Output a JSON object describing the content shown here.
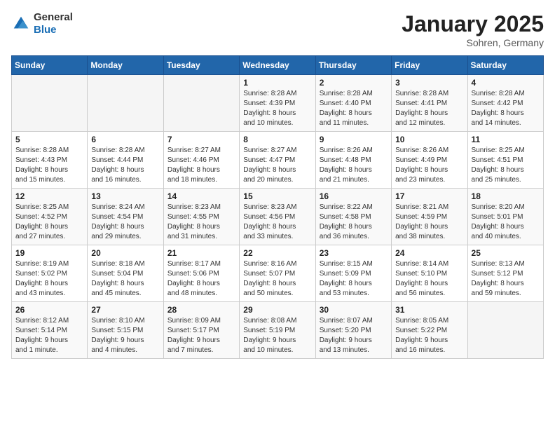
{
  "logo": {
    "text_general": "General",
    "text_blue": "Blue"
  },
  "title": "January 2025",
  "location": "Sohren, Germany",
  "weekdays": [
    "Sunday",
    "Monday",
    "Tuesday",
    "Wednesday",
    "Thursday",
    "Friday",
    "Saturday"
  ],
  "weeks": [
    [
      {
        "day": "",
        "info": ""
      },
      {
        "day": "",
        "info": ""
      },
      {
        "day": "",
        "info": ""
      },
      {
        "day": "1",
        "info": "Sunrise: 8:28 AM\nSunset: 4:39 PM\nDaylight: 8 hours\nand 10 minutes."
      },
      {
        "day": "2",
        "info": "Sunrise: 8:28 AM\nSunset: 4:40 PM\nDaylight: 8 hours\nand 11 minutes."
      },
      {
        "day": "3",
        "info": "Sunrise: 8:28 AM\nSunset: 4:41 PM\nDaylight: 8 hours\nand 12 minutes."
      },
      {
        "day": "4",
        "info": "Sunrise: 8:28 AM\nSunset: 4:42 PM\nDaylight: 8 hours\nand 14 minutes."
      }
    ],
    [
      {
        "day": "5",
        "info": "Sunrise: 8:28 AM\nSunset: 4:43 PM\nDaylight: 8 hours\nand 15 minutes."
      },
      {
        "day": "6",
        "info": "Sunrise: 8:28 AM\nSunset: 4:44 PM\nDaylight: 8 hours\nand 16 minutes."
      },
      {
        "day": "7",
        "info": "Sunrise: 8:27 AM\nSunset: 4:46 PM\nDaylight: 8 hours\nand 18 minutes."
      },
      {
        "day": "8",
        "info": "Sunrise: 8:27 AM\nSunset: 4:47 PM\nDaylight: 8 hours\nand 20 minutes."
      },
      {
        "day": "9",
        "info": "Sunrise: 8:26 AM\nSunset: 4:48 PM\nDaylight: 8 hours\nand 21 minutes."
      },
      {
        "day": "10",
        "info": "Sunrise: 8:26 AM\nSunset: 4:49 PM\nDaylight: 8 hours\nand 23 minutes."
      },
      {
        "day": "11",
        "info": "Sunrise: 8:25 AM\nSunset: 4:51 PM\nDaylight: 8 hours\nand 25 minutes."
      }
    ],
    [
      {
        "day": "12",
        "info": "Sunrise: 8:25 AM\nSunset: 4:52 PM\nDaylight: 8 hours\nand 27 minutes."
      },
      {
        "day": "13",
        "info": "Sunrise: 8:24 AM\nSunset: 4:54 PM\nDaylight: 8 hours\nand 29 minutes."
      },
      {
        "day": "14",
        "info": "Sunrise: 8:23 AM\nSunset: 4:55 PM\nDaylight: 8 hours\nand 31 minutes."
      },
      {
        "day": "15",
        "info": "Sunrise: 8:23 AM\nSunset: 4:56 PM\nDaylight: 8 hours\nand 33 minutes."
      },
      {
        "day": "16",
        "info": "Sunrise: 8:22 AM\nSunset: 4:58 PM\nDaylight: 8 hours\nand 36 minutes."
      },
      {
        "day": "17",
        "info": "Sunrise: 8:21 AM\nSunset: 4:59 PM\nDaylight: 8 hours\nand 38 minutes."
      },
      {
        "day": "18",
        "info": "Sunrise: 8:20 AM\nSunset: 5:01 PM\nDaylight: 8 hours\nand 40 minutes."
      }
    ],
    [
      {
        "day": "19",
        "info": "Sunrise: 8:19 AM\nSunset: 5:02 PM\nDaylight: 8 hours\nand 43 minutes."
      },
      {
        "day": "20",
        "info": "Sunrise: 8:18 AM\nSunset: 5:04 PM\nDaylight: 8 hours\nand 45 minutes."
      },
      {
        "day": "21",
        "info": "Sunrise: 8:17 AM\nSunset: 5:06 PM\nDaylight: 8 hours\nand 48 minutes."
      },
      {
        "day": "22",
        "info": "Sunrise: 8:16 AM\nSunset: 5:07 PM\nDaylight: 8 hours\nand 50 minutes."
      },
      {
        "day": "23",
        "info": "Sunrise: 8:15 AM\nSunset: 5:09 PM\nDaylight: 8 hours\nand 53 minutes."
      },
      {
        "day": "24",
        "info": "Sunrise: 8:14 AM\nSunset: 5:10 PM\nDaylight: 8 hours\nand 56 minutes."
      },
      {
        "day": "25",
        "info": "Sunrise: 8:13 AM\nSunset: 5:12 PM\nDaylight: 8 hours\nand 59 minutes."
      }
    ],
    [
      {
        "day": "26",
        "info": "Sunrise: 8:12 AM\nSunset: 5:14 PM\nDaylight: 9 hours\nand 1 minute."
      },
      {
        "day": "27",
        "info": "Sunrise: 8:10 AM\nSunset: 5:15 PM\nDaylight: 9 hours\nand 4 minutes."
      },
      {
        "day": "28",
        "info": "Sunrise: 8:09 AM\nSunset: 5:17 PM\nDaylight: 9 hours\nand 7 minutes."
      },
      {
        "day": "29",
        "info": "Sunrise: 8:08 AM\nSunset: 5:19 PM\nDaylight: 9 hours\nand 10 minutes."
      },
      {
        "day": "30",
        "info": "Sunrise: 8:07 AM\nSunset: 5:20 PM\nDaylight: 9 hours\nand 13 minutes."
      },
      {
        "day": "31",
        "info": "Sunrise: 8:05 AM\nSunset: 5:22 PM\nDaylight: 9 hours\nand 16 minutes."
      },
      {
        "day": "",
        "info": ""
      }
    ]
  ]
}
